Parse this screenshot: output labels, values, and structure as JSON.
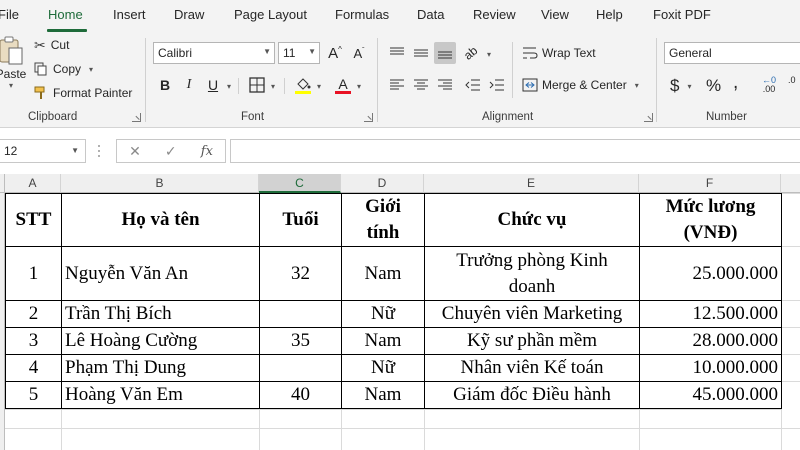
{
  "menu": {
    "tabs": [
      "File",
      "Home",
      "Insert",
      "Draw",
      "Page Layout",
      "Formulas",
      "Data",
      "Review",
      "View",
      "Help",
      "Foxit PDF"
    ],
    "active": "Home"
  },
  "ribbon": {
    "clipboard": {
      "paste_label": "Paste",
      "cut_label": "Cut",
      "copy_label": "Copy",
      "format_painter_label": "Format Painter",
      "group_label": "Clipboard"
    },
    "font": {
      "font_name": "Calibri",
      "font_size": "11",
      "bold": "B",
      "italic": "I",
      "underline": "U",
      "group_label": "Font"
    },
    "alignment": {
      "wrap_text_label": "Wrap Text",
      "merge_center_label": "Merge & Center",
      "group_label": "Alignment"
    },
    "number": {
      "format": "General",
      "currency": "$",
      "percent": "%",
      "group_label": "Number"
    },
    "colors": {
      "accent": "#1e6b3a",
      "font_highlight": "#ffff00",
      "font_color": "#e81123"
    }
  },
  "formula_bar": {
    "name_box": "12",
    "cancel": "✕",
    "enter": "✓",
    "fx": "fx",
    "content": ""
  },
  "sheet": {
    "columns": [
      "A",
      "B",
      "C",
      "D",
      "E",
      "F"
    ],
    "selected_column": "C",
    "header": {
      "stt": "STT",
      "name": "Họ và tên",
      "age": "Tuổi",
      "gender_line1": "Giới",
      "gender_line2": "tính",
      "position": "Chức vụ",
      "salary_line1": "Mức lương",
      "salary_line2": "(VNĐ)"
    },
    "rows": [
      {
        "stt": "1",
        "name": "Nguyễn Văn An",
        "age": "32",
        "gender": "Nam",
        "position_line1": "Trưởng phòng Kinh",
        "position_line2": "doanh",
        "salary": "25.000.000"
      },
      {
        "stt": "2",
        "name": "Trần Thị Bích",
        "age": "",
        "gender": "Nữ",
        "position_line1": "Chuyên viên Marketing",
        "position_line2": "",
        "salary": "12.500.000"
      },
      {
        "stt": "3",
        "name": "Lê Hoàng Cường",
        "age": "35",
        "gender": "Nam",
        "position_line1": "Kỹ sư phần mềm",
        "position_line2": "",
        "salary": "28.000.000"
      },
      {
        "stt": "4",
        "name": "Phạm Thị Dung",
        "age": "",
        "gender": "Nữ",
        "position_line1": "Nhân viên Kế toán",
        "position_line2": "",
        "salary": "10.000.000"
      },
      {
        "stt": "5",
        "name": "Hoàng Văn Em",
        "age": "40",
        "gender": "Nam",
        "position_line1": "Giám đốc Điều hành",
        "position_line2": "",
        "salary": "45.000.000"
      }
    ]
  }
}
